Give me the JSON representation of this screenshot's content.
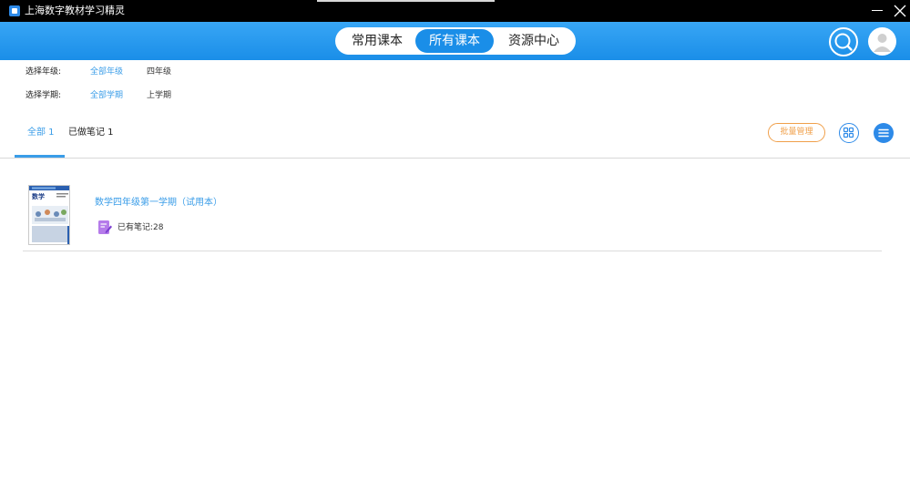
{
  "window": {
    "title": "上海数字教材学习精灵",
    "minimize_icon": "minimize-icon",
    "close_icon": "close-icon"
  },
  "header": {
    "tabs": [
      {
        "label": "常用课本",
        "active": false
      },
      {
        "label": "所有课本",
        "active": true
      },
      {
        "label": "资源中心",
        "active": false
      }
    ],
    "search_icon": "search-icon",
    "avatar_icon": "user-avatar-icon",
    "accent_color": "#1a8ee8"
  },
  "filters": {
    "grade": {
      "label": "选择年级:",
      "options": [
        {
          "label": "全部年级",
          "active": true
        },
        {
          "label": "四年级",
          "active": false
        }
      ]
    },
    "term": {
      "label": "选择学期:",
      "options": [
        {
          "label": "全部学期",
          "active": true
        },
        {
          "label": "上学期",
          "active": false
        }
      ]
    }
  },
  "subtabs": [
    {
      "label": "全部 1",
      "active": true
    },
    {
      "label": "已做笔记 1",
      "active": false
    }
  ],
  "toolbar": {
    "batch_label": "批量管理",
    "batch_color": "#f0a04b",
    "grid_view_icon": "grid-view-icon",
    "list_view_icon": "list-view-icon"
  },
  "books": [
    {
      "title": "数学四年级第一学期（试用本）",
      "cover_text": "数学",
      "notes_label": "已有笔记:28",
      "note_icon": "note-edit-icon"
    }
  ]
}
